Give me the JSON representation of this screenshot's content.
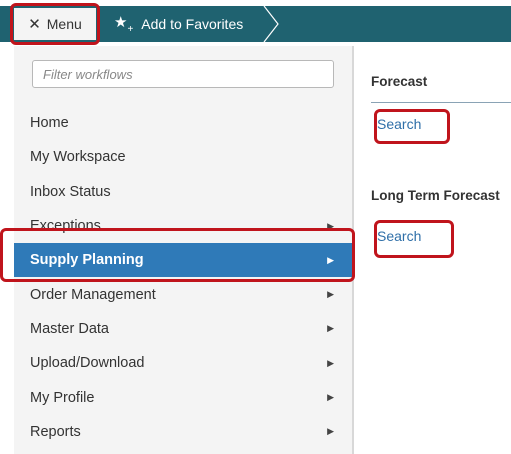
{
  "toolbar": {
    "menu_label": "Menu",
    "favorites_label": "Add to Favorites"
  },
  "sidebar": {
    "filter_placeholder": "Filter workflows",
    "items": [
      {
        "label": "Home",
        "has_submenu": false
      },
      {
        "label": "My Workspace",
        "has_submenu": false
      },
      {
        "label": "Inbox Status",
        "has_submenu": false
      },
      {
        "label": "Exceptions",
        "has_submenu": true
      },
      {
        "label": "Supply Planning",
        "has_submenu": true,
        "active": true
      },
      {
        "label": "Order Management",
        "has_submenu": true
      },
      {
        "label": "Master Data",
        "has_submenu": true
      },
      {
        "label": "Upload/Download",
        "has_submenu": true
      },
      {
        "label": "My Profile",
        "has_submenu": true
      },
      {
        "label": "Reports",
        "has_submenu": true
      }
    ]
  },
  "submenu": {
    "sections": [
      {
        "title": "Forecast",
        "link": "Search"
      },
      {
        "title": "Long Term Forecast",
        "link": "Search"
      }
    ]
  },
  "colors": {
    "header_teal": "#1f6270",
    "active_blue": "#2f7ab8",
    "link_blue": "#2f6fa8",
    "highlight_red": "#c0141c",
    "nav_bg": "#f4f4f4"
  }
}
